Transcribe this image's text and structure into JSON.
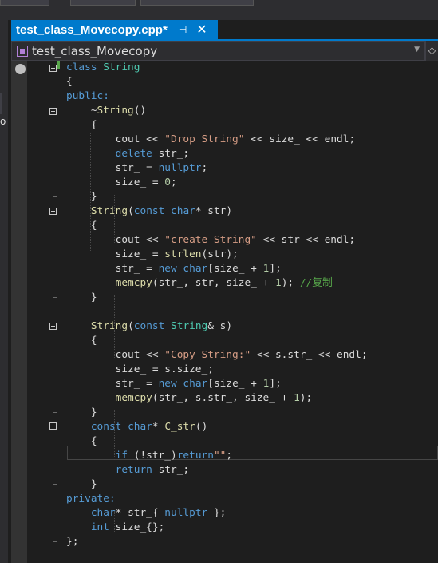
{
  "document_tab": {
    "title": "test_class_Movecopy.cpp*",
    "pin_glyph": "⊣",
    "close_glyph": "✕"
  },
  "navigation": {
    "scope": "test_class_Movecopy",
    "left_edge_letter": "o"
  },
  "code_lines": [
    [
      {
        "t": "class ",
        "c": "kw"
      },
      {
        "t": "String",
        "c": "ty"
      }
    ],
    [
      {
        "t": "{",
        "c": ""
      }
    ],
    [
      {
        "t": "public:",
        "c": "kw"
      }
    ],
    [
      {
        "t": "    ~",
        "c": ""
      },
      {
        "t": "String",
        "c": "fn"
      },
      {
        "t": "()",
        "c": ""
      }
    ],
    [
      {
        "t": "    {",
        "c": ""
      }
    ],
    [
      {
        "t": "        cout << ",
        "c": ""
      },
      {
        "t": "\"Drop String\"",
        "c": "st"
      },
      {
        "t": " << ",
        "c": ""
      },
      {
        "t": "size_",
        "c": "var"
      },
      {
        "t": " << ",
        "c": ""
      },
      {
        "t": "endl",
        "c": ""
      },
      {
        "t": ";",
        "c": ""
      }
    ],
    [
      {
        "t": "        ",
        "c": ""
      },
      {
        "t": "delete",
        "c": "kw"
      },
      {
        "t": " str_;",
        "c": ""
      }
    ],
    [
      {
        "t": "        str_ = ",
        "c": ""
      },
      {
        "t": "nullptr",
        "c": "kw"
      },
      {
        "t": ";",
        "c": ""
      }
    ],
    [
      {
        "t": "        size_ = ",
        "c": ""
      },
      {
        "t": "0",
        "c": "nm"
      },
      {
        "t": ";",
        "c": ""
      }
    ],
    [
      {
        "t": "    }",
        "c": ""
      }
    ],
    [
      {
        "t": "    ",
        "c": ""
      },
      {
        "t": "String",
        "c": "fn"
      },
      {
        "t": "(",
        "c": ""
      },
      {
        "t": "const",
        "c": "kw"
      },
      {
        "t": " ",
        "c": ""
      },
      {
        "t": "char",
        "c": "kw"
      },
      {
        "t": "* str)",
        "c": ""
      }
    ],
    [
      {
        "t": "    {",
        "c": ""
      }
    ],
    [
      {
        "t": "        cout << ",
        "c": ""
      },
      {
        "t": "\"create String\"",
        "c": "st"
      },
      {
        "t": " << str << endl;",
        "c": ""
      }
    ],
    [
      {
        "t": "        size_ = ",
        "c": ""
      },
      {
        "t": "strlen",
        "c": "fn"
      },
      {
        "t": "(str);",
        "c": ""
      }
    ],
    [
      {
        "t": "        str_ = ",
        "c": ""
      },
      {
        "t": "new",
        "c": "kw"
      },
      {
        "t": " ",
        "c": ""
      },
      {
        "t": "char",
        "c": "kw"
      },
      {
        "t": "[size_ + ",
        "c": ""
      },
      {
        "t": "1",
        "c": "nm"
      },
      {
        "t": "];",
        "c": ""
      }
    ],
    [
      {
        "t": "        ",
        "c": ""
      },
      {
        "t": "memcpy",
        "c": "fn"
      },
      {
        "t": "(str_, str, size_ + ",
        "c": ""
      },
      {
        "t": "1",
        "c": "nm"
      },
      {
        "t": "); ",
        "c": ""
      },
      {
        "t": "//复制",
        "c": "cm"
      }
    ],
    [
      {
        "t": "    }",
        "c": ""
      }
    ],
    [
      {
        "t": "",
        "c": ""
      }
    ],
    [
      {
        "t": "    ",
        "c": ""
      },
      {
        "t": "String",
        "c": "fn"
      },
      {
        "t": "(",
        "c": ""
      },
      {
        "t": "const",
        "c": "kw"
      },
      {
        "t": " ",
        "c": ""
      },
      {
        "t": "String",
        "c": "ty"
      },
      {
        "t": "& s)",
        "c": ""
      }
    ],
    [
      {
        "t": "    {",
        "c": ""
      }
    ],
    [
      {
        "t": "        cout << ",
        "c": ""
      },
      {
        "t": "\"Copy String:\"",
        "c": "st"
      },
      {
        "t": " << s.str_ << endl;",
        "c": ""
      }
    ],
    [
      {
        "t": "        size_ = s.size_;",
        "c": ""
      }
    ],
    [
      {
        "t": "        str_ = ",
        "c": ""
      },
      {
        "t": "new",
        "c": "kw"
      },
      {
        "t": " ",
        "c": ""
      },
      {
        "t": "char",
        "c": "kw"
      },
      {
        "t": "[size_ + ",
        "c": ""
      },
      {
        "t": "1",
        "c": "nm"
      },
      {
        "t": "];",
        "c": ""
      }
    ],
    [
      {
        "t": "        ",
        "c": ""
      },
      {
        "t": "memcpy",
        "c": "fn"
      },
      {
        "t": "(str_, s.str_, size_ + ",
        "c": ""
      },
      {
        "t": "1",
        "c": "nm"
      },
      {
        "t": ");",
        "c": ""
      }
    ],
    [
      {
        "t": "    }",
        "c": ""
      }
    ],
    [
      {
        "t": "    ",
        "c": ""
      },
      {
        "t": "const",
        "c": "kw"
      },
      {
        "t": " ",
        "c": ""
      },
      {
        "t": "char",
        "c": "kw"
      },
      {
        "t": "* ",
        "c": ""
      },
      {
        "t": "C_str",
        "c": "fn"
      },
      {
        "t": "()",
        "c": ""
      }
    ],
    [
      {
        "t": "    {",
        "c": ""
      }
    ],
    [
      {
        "t": "        ",
        "c": ""
      },
      {
        "t": "if",
        "c": "kw"
      },
      {
        "t": " (!str_)",
        "c": ""
      },
      {
        "t": "return",
        "c": "kw"
      },
      {
        "t": "\"\"",
        "c": "st"
      },
      {
        "t": ";",
        "c": ""
      }
    ],
    [
      {
        "t": "        ",
        "c": ""
      },
      {
        "t": "return",
        "c": "kw"
      },
      {
        "t": " str_;",
        "c": ""
      }
    ],
    [
      {
        "t": "    }",
        "c": ""
      }
    ],
    [
      {
        "t": "private:",
        "c": "kw"
      }
    ],
    [
      {
        "t": "    ",
        "c": ""
      },
      {
        "t": "char",
        "c": "kw"
      },
      {
        "t": "* str_{ ",
        "c": ""
      },
      {
        "t": "nullptr",
        "c": "kw"
      },
      {
        "t": " };",
        "c": ""
      }
    ],
    [
      {
        "t": "    ",
        "c": ""
      },
      {
        "t": "int",
        "c": "kw"
      },
      {
        "t": " size_{};",
        "c": ""
      }
    ],
    [
      {
        "t": "};",
        "c": ""
      }
    ]
  ],
  "colors": {
    "editor_background": "#1e1e1e",
    "active_tab": "#007acc",
    "keyword": "#569cd6",
    "type": "#4ec9b0",
    "string": "#d69d85",
    "number": "#b5cea8",
    "function": "#dcdcaa",
    "comment": "#57a64a"
  }
}
